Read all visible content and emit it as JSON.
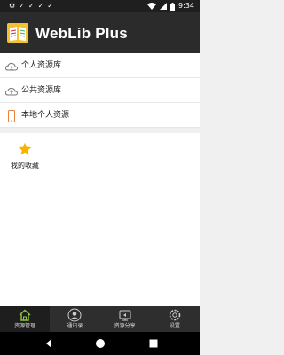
{
  "status_bar": {
    "left_icons": [
      "gear-icon",
      "check-icon",
      "check-icon",
      "check-icon",
      "check-icon"
    ],
    "right_icons": [
      "wifi-icon",
      "signal-icon",
      "battery-icon"
    ],
    "time": "9:34"
  },
  "header": {
    "title_web": "Web",
    "title_l": "L",
    "title_rest": "ib Plus",
    "logo_icon": "book-logo-icon"
  },
  "resource_list": [
    {
      "label": "个人资源库",
      "icon": "cloud-user-icon"
    },
    {
      "label": "公共资源库",
      "icon": "cloud-upload-icon"
    },
    {
      "label": "本地个人资源",
      "icon": "phone-icon"
    }
  ],
  "favorites": {
    "label": "我的收藏",
    "icon": "star-icon"
  },
  "tabs": [
    {
      "label": "资源管理",
      "icon": "home-icon",
      "active": true
    },
    {
      "label": "通讯录",
      "icon": "contact-icon",
      "active": false
    },
    {
      "label": "资源分享",
      "icon": "share-icon",
      "active": false
    },
    {
      "label": "设置",
      "icon": "settings-icon",
      "active": false
    }
  ],
  "colors": {
    "header_bg": "#2b2b2b",
    "accent_green": "#8cc63f",
    "star_yellow": "#f4b400",
    "phone_orange": "#e8823a"
  }
}
